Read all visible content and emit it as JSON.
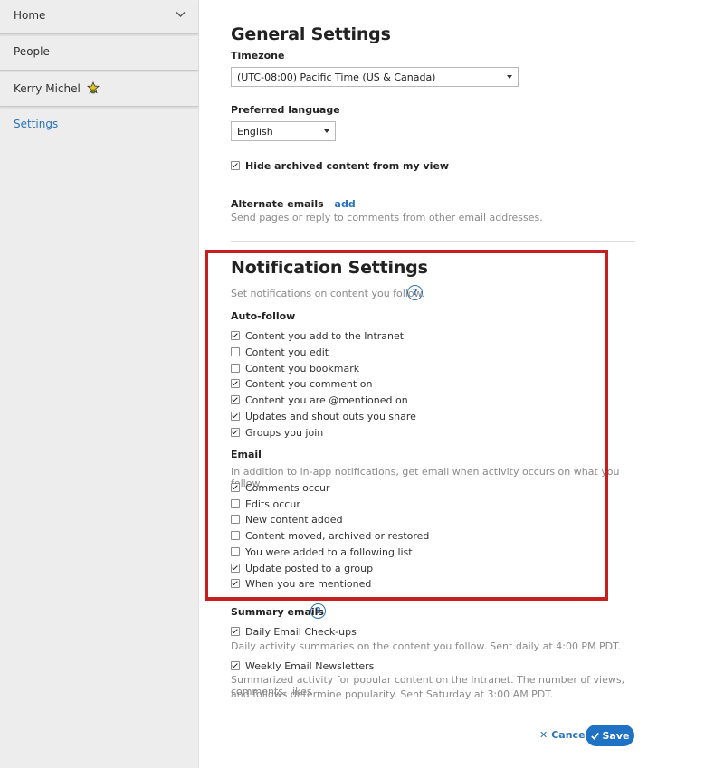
{
  "sidebar": {
    "items": [
      {
        "label": "Home"
      },
      {
        "label": "People"
      },
      {
        "label": "Kerry Michel"
      },
      {
        "label": "Settings"
      }
    ]
  },
  "general": {
    "title": "General Settings",
    "timezone_label": "Timezone",
    "timezone_value": "(UTC-08:00) Pacific Time (US & Canada)",
    "language_label": "Preferred language",
    "language_value": "English",
    "hide_archived": {
      "label": "Hide archived content from my view",
      "checked": true
    },
    "alt_emails_label": "Alternate emails",
    "alt_emails_add": "add",
    "alt_emails_desc": "Send pages or reply to comments from other email addresses."
  },
  "notifications": {
    "title": "Notification Settings",
    "desc": "Set notifications on content you follow.",
    "help": "?",
    "autofollow_label": "Auto-follow",
    "autofollow": [
      {
        "label": "Content you add to the Intranet",
        "checked": true
      },
      {
        "label": "Content you edit",
        "checked": false
      },
      {
        "label": "Content you bookmark",
        "checked": false
      },
      {
        "label": "Content you comment on",
        "checked": true
      },
      {
        "label": "Content you are @mentioned on",
        "checked": true
      },
      {
        "label": "Updates and shout outs you share",
        "checked": true
      },
      {
        "label": "Groups you join",
        "checked": true
      }
    ],
    "email_label": "Email",
    "email_desc": "In addition to in-app notifications, get email when activity occurs on what you follow.",
    "email": [
      {
        "label": "Comments occur",
        "checked": true
      },
      {
        "label": "Edits occur",
        "checked": false
      },
      {
        "label": "New content added",
        "checked": false
      },
      {
        "label": "Content moved, archived or restored",
        "checked": false
      },
      {
        "label": "You were added to a following list",
        "checked": false
      },
      {
        "label": "Update posted to a group",
        "checked": true
      },
      {
        "label": "When you are mentioned",
        "checked": true
      }
    ]
  },
  "summary": {
    "label": "Summary emails",
    "help": "?",
    "daily": {
      "label": "Daily Email Check-ups",
      "checked": true
    },
    "daily_desc": "Daily activity summaries on the content you follow. Sent daily at 4:00 PM PDT.",
    "weekly": {
      "label": "Weekly Email Newsletters",
      "checked": true
    },
    "weekly_desc_1": "Summarized activity for popular content on the Intranet. The number of views, comments, likes",
    "weekly_desc_2": "and follows determine popularity. Sent Saturday at 3:00 AM PDT."
  },
  "actions": {
    "cancel_label": "Cancel",
    "save_label": "Save"
  },
  "colors": {
    "accent": "#2a73b8",
    "highlight": "#c51f1f",
    "save_bg": "#1f72c4"
  }
}
